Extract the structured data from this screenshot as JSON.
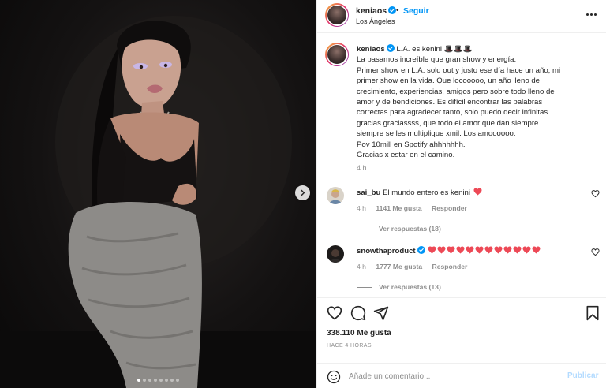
{
  "post": {
    "username": "keniaos",
    "follow_separator": "•",
    "follow_label": "Seguir",
    "location": "Los Ángeles",
    "more_label": "Más opciones",
    "verified": true
  },
  "caption": {
    "username": "keniaos",
    "lines": [
      "L.A. es kenini 🎩🎩🎩",
      "La pasamos increíble que gran show y energía.",
      "Primer show en L.A. sold out y justo ese día hace un año, mi",
      "primer show en la vida. Que locooooo, un año lleno de",
      "crecimiento, experiencias, amigos pero sobre todo lleno de",
      "amor y de bendiciones. Es difícil encontrar las palabras",
      "correctas para agradecer tanto, solo puedo decir infinitas",
      "gracias graciassss, que todo el amor que dan siempre",
      "siempre se les multiplique xmil. Los amoooooo.",
      "Pov 10mill en Spotify ahhhhhhh.",
      "Gracias x estar en el camino."
    ],
    "time": "4 h"
  },
  "comments": [
    {
      "username": "sai_bu",
      "text": "El mundo entero es kenini",
      "heart_count": 1,
      "time": "4 h",
      "likes": "1141 Me gusta",
      "reply_label": "Responder",
      "view_replies": "Ver respuestas (18)",
      "verified": false
    },
    {
      "username": "snowthaproduct",
      "text": "",
      "heart_count": 12,
      "time": "4 h",
      "likes": "1777 Me gusta",
      "reply_label": "Responder",
      "view_replies": "Ver respuestas (13)",
      "verified": true
    }
  ],
  "actions": {
    "likes": "338.110 Me gusta",
    "posted": "HACE 4 HORAS"
  },
  "composer": {
    "placeholder": "Añade un comentario...",
    "publish_label": "Publicar"
  },
  "carousel": {
    "slide_count": 8,
    "active_index": 0
  },
  "colors": {
    "accent": "#0095f6",
    "heart": "#ed4956",
    "muted": "#8e8e8e",
    "text": "#262626"
  },
  "icons": [
    "chevron-right-icon",
    "verified-badge-icon",
    "more-icon",
    "heart-icon",
    "comment-icon",
    "share-icon",
    "bookmark-icon",
    "emoji-icon"
  ]
}
